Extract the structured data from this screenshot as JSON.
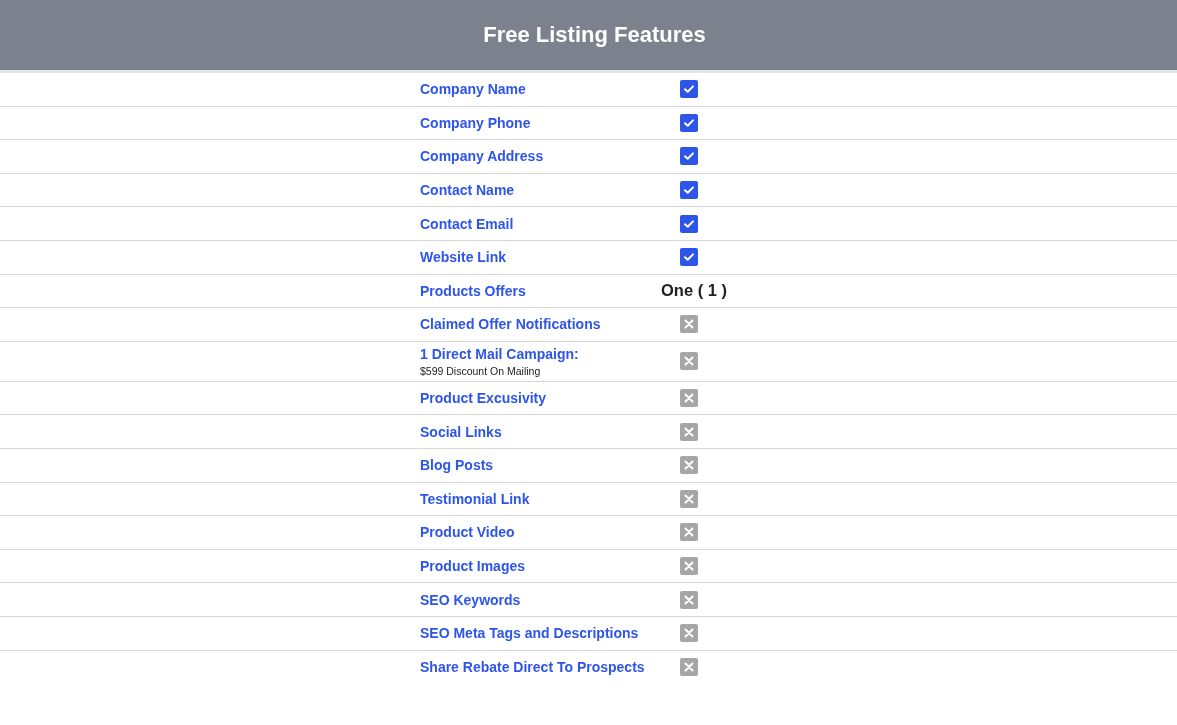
{
  "header": {
    "title": "Free Listing Features"
  },
  "features": [
    {
      "label": "Company Name",
      "kind": "check",
      "checked": true
    },
    {
      "label": "Company Phone",
      "kind": "check",
      "checked": true
    },
    {
      "label": "Company Address",
      "kind": "check",
      "checked": true
    },
    {
      "label": "Contact Name",
      "kind": "check",
      "checked": true
    },
    {
      "label": "Contact Email",
      "kind": "check",
      "checked": true
    },
    {
      "label": "Website Link",
      "kind": "check",
      "checked": true
    },
    {
      "label": "Products Offers",
      "kind": "text",
      "value": "One ( 1 )"
    },
    {
      "label": "Claimed Offer Notifications",
      "kind": "check",
      "checked": false
    },
    {
      "label": "1 Direct Mail Campaign:",
      "note": "$599 Discount On Mailing",
      "kind": "check",
      "checked": false
    },
    {
      "label": "Product Excusivity",
      "kind": "check",
      "checked": false
    },
    {
      "label": "Social Links",
      "kind": "check",
      "checked": false
    },
    {
      "label": "Blog Posts",
      "kind": "check",
      "checked": false
    },
    {
      "label": "Testimonial Link",
      "kind": "check",
      "checked": false
    },
    {
      "label": "Product Video",
      "kind": "check",
      "checked": false
    },
    {
      "label": "Product Images",
      "kind": "check",
      "checked": false
    },
    {
      "label": "SEO Keywords",
      "kind": "check",
      "checked": false
    },
    {
      "label": "SEO Meta Tags and Descriptions",
      "kind": "check",
      "checked": false
    },
    {
      "label": "Share Rebate Direct To Prospects",
      "kind": "check",
      "checked": false
    }
  ]
}
